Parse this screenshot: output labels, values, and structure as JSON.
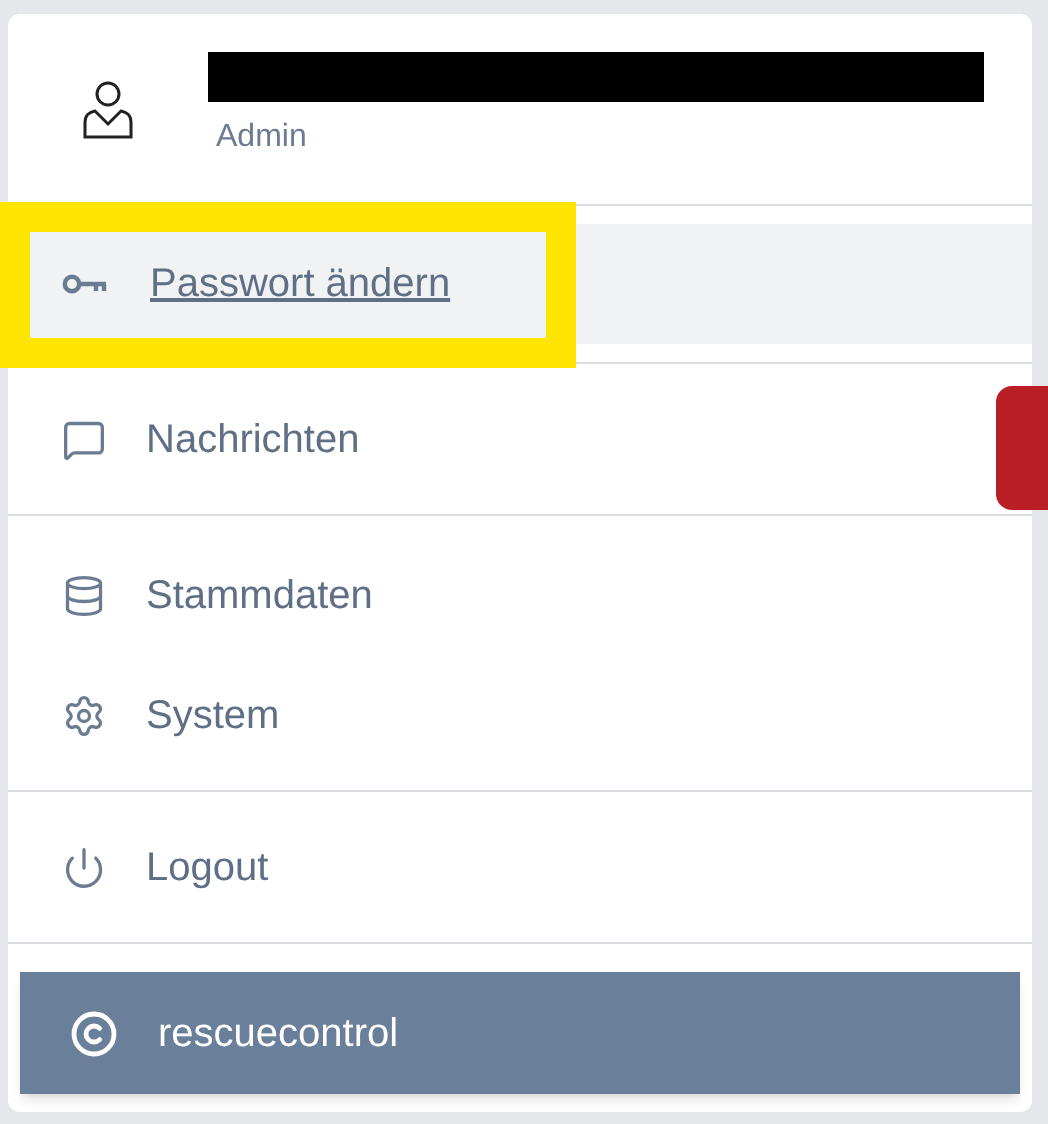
{
  "user": {
    "role": "Admin",
    "name_redacted": true
  },
  "menu_sections": [
    {
      "items": [
        {
          "label": "Passwort ändern",
          "selected": true,
          "highlighted": true
        }
      ]
    },
    {
      "items": [
        {
          "label": "Nachrichten",
          "selected": false,
          "highlighted": false
        }
      ]
    },
    {
      "items": [
        {
          "label": "Stammdaten",
          "selected": false,
          "highlighted": false
        },
        {
          "label": "System",
          "selected": false,
          "highlighted": false
        }
      ]
    },
    {
      "items": [
        {
          "label": "Logout",
          "selected": false,
          "highlighted": false
        }
      ]
    }
  ],
  "footer": {
    "label": "rescuecontrol"
  }
}
